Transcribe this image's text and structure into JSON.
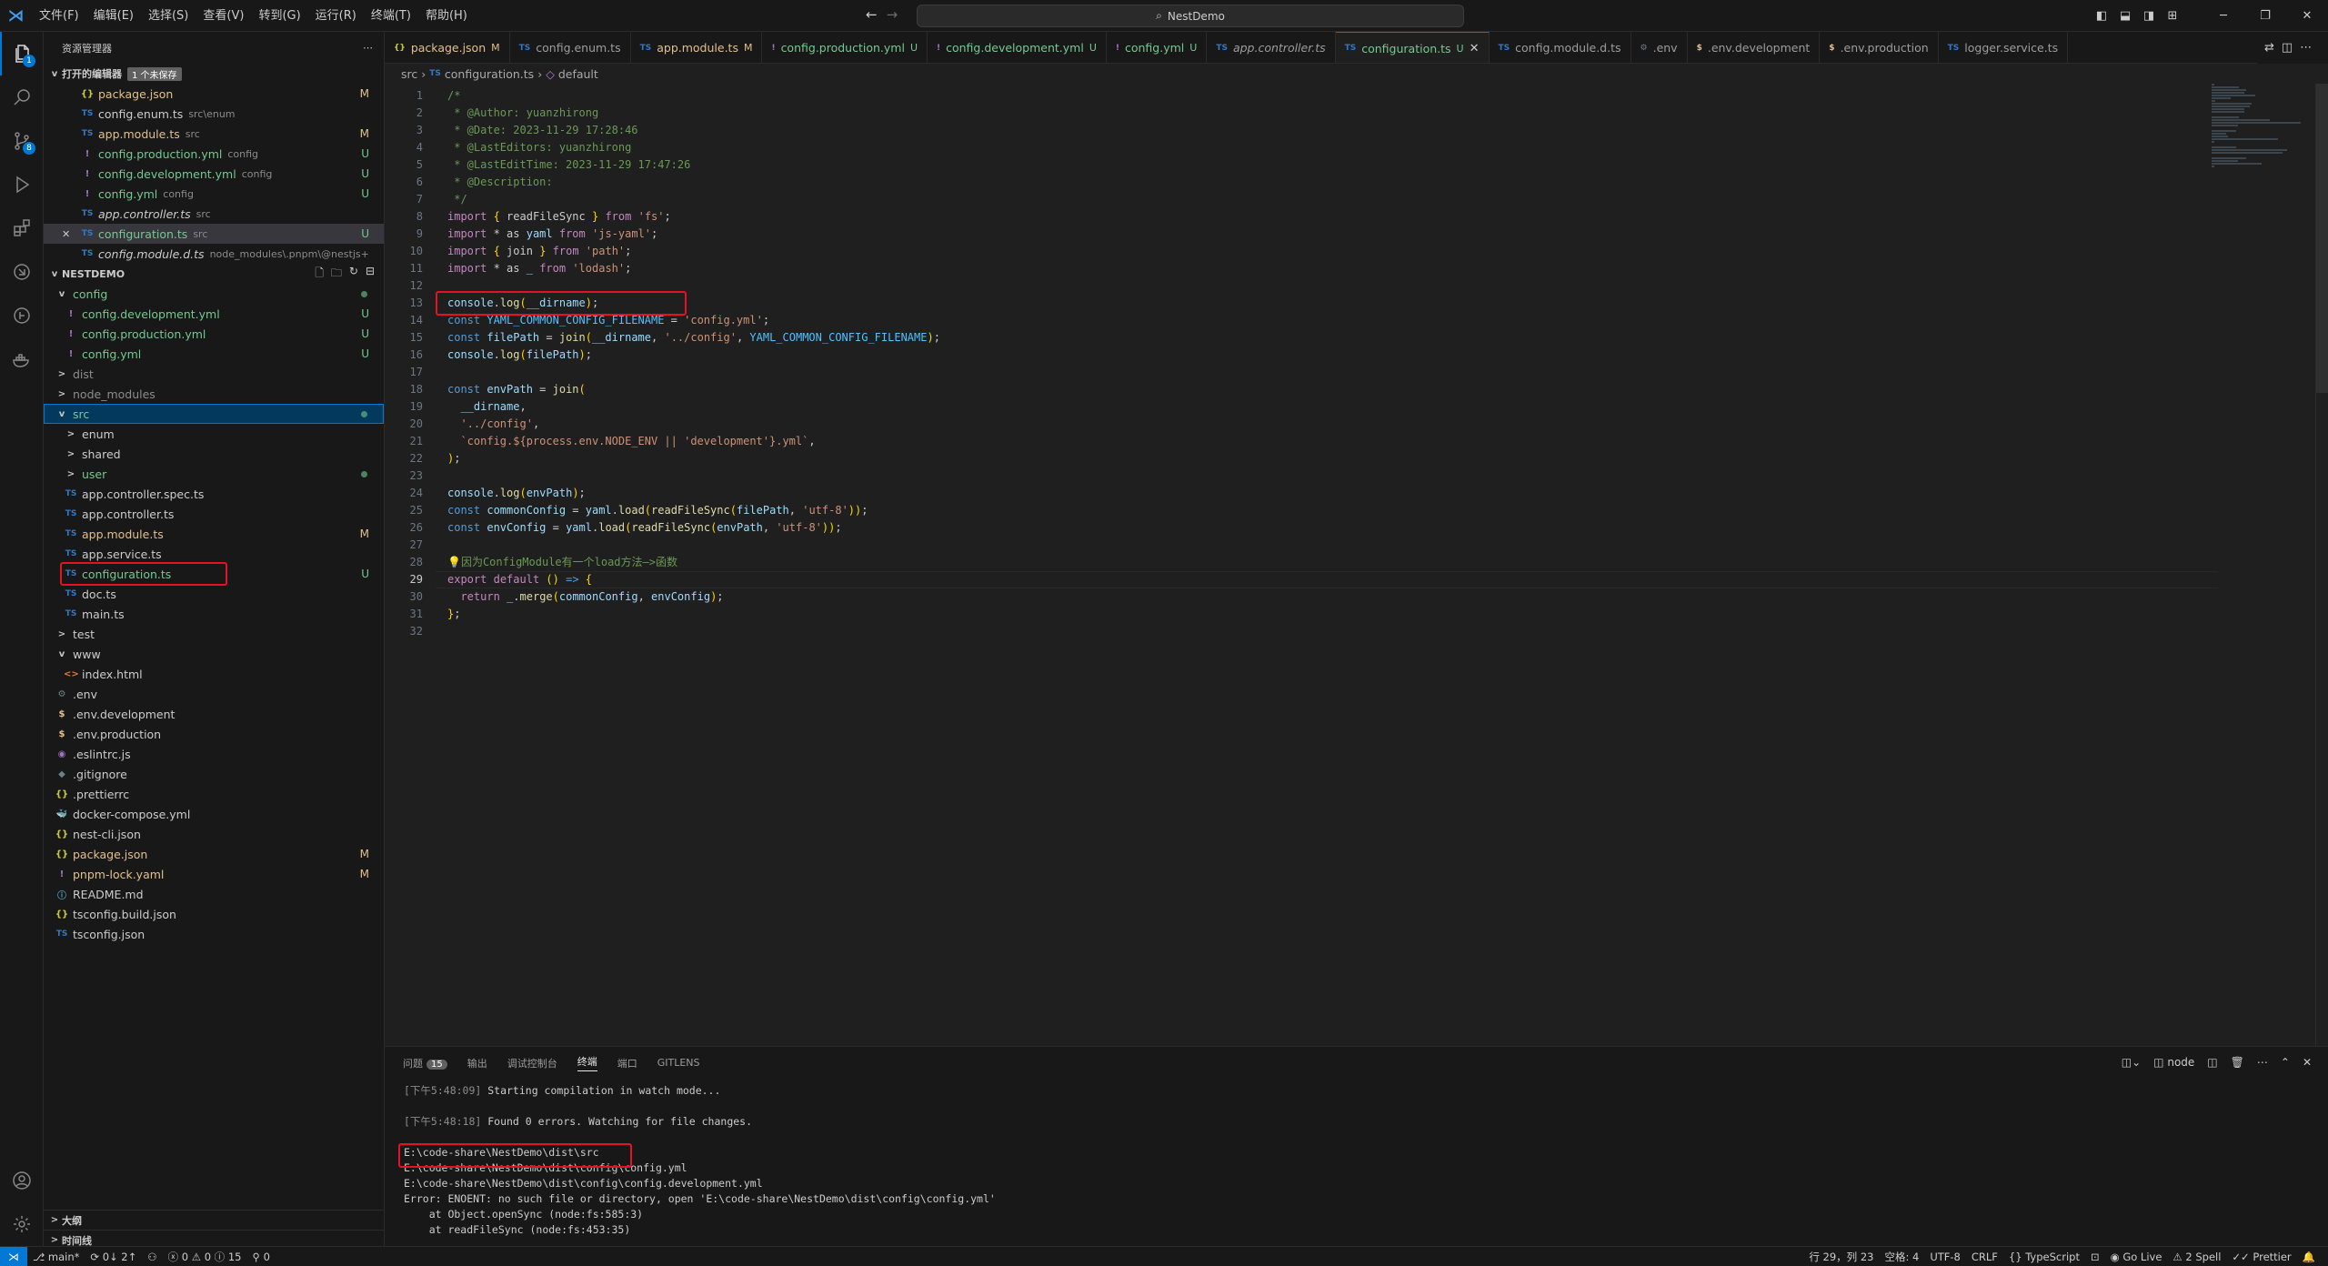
{
  "titlebar": {
    "menus": [
      "文件(F)",
      "编辑(E)",
      "选择(S)",
      "查看(V)",
      "转到(G)",
      "运行(R)",
      "终端(T)",
      "帮助(H)"
    ],
    "search": "NestDemo"
  },
  "activity": {
    "explorer_badge": "1",
    "scm_badge": "8"
  },
  "sidebar": {
    "title": "资源管理器",
    "open_editors_title": "打开的编辑器",
    "unsaved_label": "1 个未保存",
    "open_editors": [
      {
        "icon": "{}",
        "name": "package.json",
        "desc": "",
        "status": "M"
      },
      {
        "icon": "TS",
        "name": "config.enum.ts",
        "desc": "src\\enum",
        "status": ""
      },
      {
        "icon": "TS",
        "name": "app.module.ts",
        "desc": "src",
        "status": "M"
      },
      {
        "icon": "!",
        "name": "config.production.yml",
        "desc": "config",
        "status": "U"
      },
      {
        "icon": "!",
        "name": "config.development.yml",
        "desc": "config",
        "status": "U"
      },
      {
        "icon": "!",
        "name": "config.yml",
        "desc": "config",
        "status": "U"
      },
      {
        "icon": "TS",
        "name": "app.controller.ts",
        "desc": "src",
        "status": ""
      },
      {
        "icon": "TS",
        "name": "configuration.ts",
        "desc": "src",
        "status": "U"
      },
      {
        "icon": "TS",
        "name": "config.module.d.ts",
        "desc": "node_modules\\.pnpm\\@nestjs+conf...",
        "status": ""
      }
    ],
    "project_title": "NESTDEMO",
    "tree": [
      {
        "icon": "v",
        "name": "config",
        "status": "",
        "folder": true
      },
      {
        "icon": "!",
        "name": "config.development.yml",
        "status": "U"
      },
      {
        "icon": "!",
        "name": "config.production.yml",
        "status": "U"
      },
      {
        "icon": "!",
        "name": "config.yml",
        "status": "U"
      },
      {
        "icon": ">",
        "name": "dist",
        "status": "",
        "folder": true
      },
      {
        "icon": ">",
        "name": "node_modules",
        "status": "",
        "folder": true
      },
      {
        "icon": "v",
        "name": "src",
        "status": "",
        "folder": true
      },
      {
        "icon": ">",
        "name": "enum",
        "status": "",
        "folder": true
      },
      {
        "icon": ">",
        "name": "shared",
        "status": "",
        "folder": true
      },
      {
        "icon": ">",
        "name": "user",
        "status": "",
        "folder": true
      },
      {
        "icon": "TS",
        "name": "app.controller.spec.ts",
        "status": ""
      },
      {
        "icon": "TS",
        "name": "app.controller.ts",
        "status": ""
      },
      {
        "icon": "TS",
        "name": "app.module.ts",
        "status": "M"
      },
      {
        "icon": "TS",
        "name": "app.service.ts",
        "status": ""
      },
      {
        "icon": "TS",
        "name": "configuration.ts",
        "status": "U"
      },
      {
        "icon": "TS",
        "name": "doc.ts",
        "status": ""
      },
      {
        "icon": "TS",
        "name": "main.ts",
        "status": ""
      },
      {
        "icon": ">",
        "name": "test",
        "status": "",
        "folder": true
      },
      {
        "icon": "v",
        "name": "www",
        "status": "",
        "folder": true
      },
      {
        "icon": "<>",
        "name": "index.html",
        "status": ""
      },
      {
        "icon": "⚙",
        "name": ".env",
        "status": ""
      },
      {
        "icon": "$",
        "name": ".env.development",
        "status": ""
      },
      {
        "icon": "$",
        "name": ".env.production",
        "status": ""
      },
      {
        "icon": "◉",
        "name": ".eslintrc.js",
        "status": ""
      },
      {
        "icon": "◆",
        "name": ".gitignore",
        "status": ""
      },
      {
        "icon": "{}",
        "name": ".prettierrc",
        "status": ""
      },
      {
        "icon": "🐳",
        "name": "docker-compose.yml",
        "status": ""
      },
      {
        "icon": "{}",
        "name": "nest-cli.json",
        "status": ""
      },
      {
        "icon": "{}",
        "name": "package.json",
        "status": "M"
      },
      {
        "icon": "!",
        "name": "pnpm-lock.yaml",
        "status": "M"
      },
      {
        "icon": "ⓘ",
        "name": "README.md",
        "status": ""
      },
      {
        "icon": "{}",
        "name": "tsconfig.build.json",
        "status": ""
      },
      {
        "icon": "TS",
        "name": "tsconfig.json",
        "status": ""
      }
    ],
    "outline_title": "大纲",
    "timeline_title": "时间线"
  },
  "tabs": [
    {
      "icon": "{}",
      "label": "package.json",
      "mark": "M"
    },
    {
      "icon": "TS",
      "label": "config.enum.ts",
      "mark": ""
    },
    {
      "icon": "TS",
      "label": "app.module.ts",
      "mark": "M"
    },
    {
      "icon": "!",
      "label": "config.production.yml",
      "mark": "U"
    },
    {
      "icon": "!",
      "label": "config.development.yml",
      "mark": "U"
    },
    {
      "icon": "!",
      "label": "config.yml",
      "mark": "U"
    },
    {
      "icon": "TS",
      "label": "app.controller.ts",
      "mark": ""
    },
    {
      "icon": "TS",
      "label": "configuration.ts",
      "mark": "U"
    },
    {
      "icon": "TS",
      "label": "config.module.d.ts",
      "mark": ""
    },
    {
      "icon": "⚙",
      "label": ".env",
      "mark": ""
    },
    {
      "icon": "$",
      "label": ".env.development",
      "mark": ""
    },
    {
      "icon": "$",
      "label": ".env.production",
      "mark": ""
    },
    {
      "icon": "TS",
      "label": "logger.service.ts",
      "mark": ""
    }
  ],
  "breadcrumb": {
    "part1": "src",
    "part2": "configuration.ts",
    "part3": "default"
  },
  "code_lines": [
    "/*",
    " * @Author: yuanzhirong",
    " * @Date: 2023-11-29 17:28:46",
    " * @LastEditors: yuanzhirong",
    " * @LastEditTime: 2023-11-29 17:47:26",
    " * @Description:",
    " */",
    "import { readFileSync } from 'fs';",
    "import * as yaml from 'js-yaml';",
    "import { join } from 'path';",
    "import * as _ from 'lodash';",
    "",
    "console.log(__dirname);",
    "const YAML_COMMON_CONFIG_FILENAME = 'config.yml';",
    "const filePath = join(__dirname, '../config', YAML_COMMON_CONFIG_FILENAME);",
    "console.log(filePath);",
    "",
    "const envPath = join(",
    "  __dirname,",
    "  '../config',",
    "  `config.${process.env.NODE_ENV || 'development'}.yml`,",
    ");",
    "",
    "console.log(envPath);",
    "const commonConfig = yaml.load(readFileSync(filePath, 'utf-8'));",
    "const envConfig = yaml.load(readFileSync(envPath, 'utf-8'));",
    "",
    "💡因为ConfigModule有一个load方法—>函数",
    "export default () => {",
    "  return _.merge(commonConfig, envConfig);",
    "};",
    ""
  ],
  "panel": {
    "tabs": [
      "问题",
      "输出",
      "调试控制台",
      "终端",
      "端口",
      "GITLENS"
    ],
    "problems_count": "15",
    "terminal_name": "node",
    "lines": [
      {
        "ts": "[下午5:48:09]",
        "text": " Starting compilation in watch mode..."
      },
      {
        "ts": "",
        "text": ""
      },
      {
        "ts": "[下午5:48:18]",
        "text": " Found 0 errors. Watching for file changes."
      },
      {
        "ts": "",
        "text": ""
      },
      {
        "ts": "",
        "text": "E:\\code-share\\NestDemo\\dist\\src"
      },
      {
        "ts": "",
        "text": "E:\\code-share\\NestDemo\\dist\\config\\config.yml"
      },
      {
        "ts": "",
        "text": "E:\\code-share\\NestDemo\\dist\\config\\config.development.yml"
      },
      {
        "ts": "",
        "text": "Error: ENOENT: no such file or directory, open 'E:\\code-share\\NestDemo\\dist\\config\\config.yml'"
      },
      {
        "ts": "",
        "text": "    at Object.openSync (node:fs:585:3)"
      },
      {
        "ts": "",
        "text": "    at readFileSync (node:fs:453:35)"
      }
    ]
  },
  "status": {
    "branch": "main*",
    "sync": "0↓ 2↑",
    "errors": "0",
    "warnings": "0",
    "infos": "15",
    "ports": "0",
    "position": "行 29，列 23",
    "spaces": "空格: 4",
    "encoding": "UTF-8",
    "eol": "CRLF",
    "language": "TypeScript",
    "golive": "Go Live",
    "spell": "2 Spell",
    "prettier": "Prettier"
  }
}
